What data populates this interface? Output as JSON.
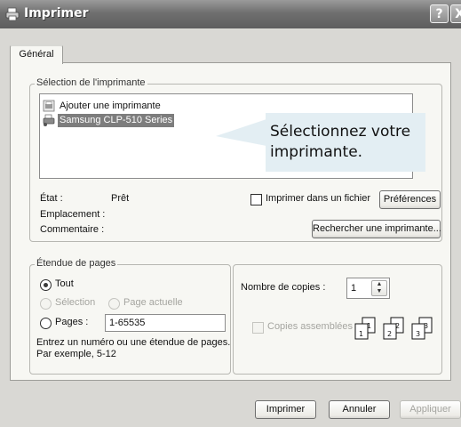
{
  "window": {
    "title": "Imprimer",
    "help_label": "?",
    "close_label": "X"
  },
  "tabs": [
    {
      "label": "Général"
    }
  ],
  "printer_selection": {
    "group_title": "Sélection de l'imprimante",
    "items": [
      {
        "label": "Ajouter une imprimante",
        "icon": "add-printer-icon"
      },
      {
        "label": "Samsung CLP-510 Series",
        "icon": "printer-icon",
        "selected": true
      }
    ],
    "callout_line1": "Sélectionnez votre",
    "callout_line2": "imprimante.",
    "status_label": "État :",
    "status_value": "Prêt",
    "location_label": "Emplacement :",
    "comment_label": "Commentaire :",
    "print_to_file_label": "Imprimer dans un fichier",
    "preferences_button": "Préférences",
    "find_printer_button": "Rechercher une imprimante..."
  },
  "page_range": {
    "group_title": "Étendue de pages",
    "all_label": "Tout",
    "selection_label": "Sélection",
    "current_page_label": "Page actuelle",
    "pages_label": "Pages :",
    "pages_value": "1-65535",
    "hint_line1": "Entrez un numéro ou une étendue de pages.",
    "hint_line2": "Par exemple, 5-12"
  },
  "copies": {
    "count_label": "Nombre de copies :",
    "count_value": "1",
    "collate_label": "Copies assemblées",
    "collate_digits": [
      "1",
      "1",
      "2",
      "2",
      "3",
      "3"
    ]
  },
  "footer": {
    "print_button": "Imprimer",
    "cancel_button": "Annuler",
    "apply_button": "Appliquer"
  }
}
